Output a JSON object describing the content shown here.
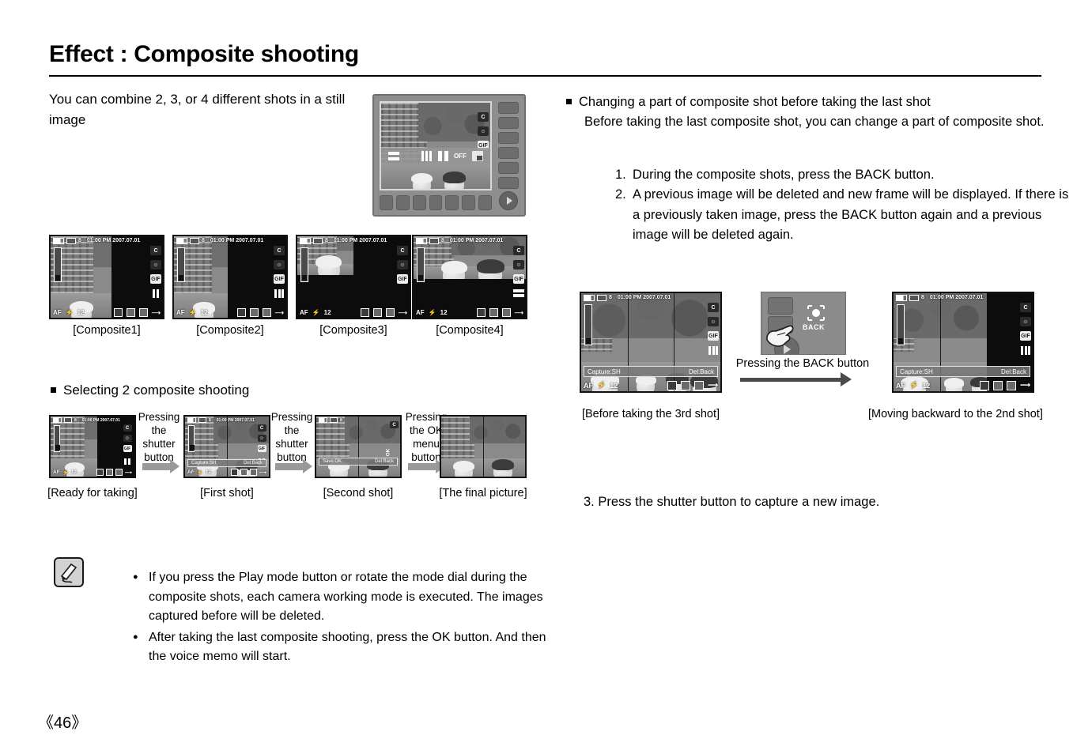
{
  "page": {
    "title": "Effect : Composite shooting",
    "number": "《46》"
  },
  "left": {
    "intro": "You can combine 2, 3, or 4 different shots in a still image",
    "composite_labels": [
      "[Composite1]",
      "[Composite2]",
      "[Composite3]",
      "[Composite4]"
    ],
    "section_heading": "Selecting 2 composite shooting",
    "sequence_labels": [
      "[Ready for taking]",
      "[First shot]",
      "[Second shot]",
      "[The final picture]"
    ],
    "sequence_actions": [
      "Pressing\nthe shutter\nbutton",
      "Pressing\nthe shutter\nbutton",
      "Pressing\nthe OK\nmenu button"
    ],
    "notes": [
      "If you press the Play mode button or rotate the mode dial during the composite shots, each camera working mode is executed. The images captured before will be deleted.",
      "After taking the last composite shooting, press the OK button. And then the voice memo will start."
    ],
    "note_icon": "pencil-note-icon"
  },
  "right": {
    "heading": "Changing a part of composite shot before taking the last shot",
    "subheading": "Before taking the last composite shot, you can change a part of composite shot.",
    "steps": [
      {
        "num": "1.",
        "text": "During the composite shots, press the BACK button."
      },
      {
        "num": "2.",
        "text": "A previous image will be deleted and new frame will be displayed. If there is a previously taken image, press the BACK button again and a previous image will be deleted again."
      }
    ],
    "step3": "3. Press the shutter button to capture a new image.",
    "figure_labels": {
      "left": "[Before taking the 3rd shot]",
      "right": "[Moving backward to the 2nd shot]",
      "middle": "Pressing the BACK button"
    },
    "back_button_word": "BACK"
  },
  "lcd": {
    "datetime": "01:00 PM 2007.07.01",
    "shots_remaining": "8",
    "af": "AF",
    "resolution": "12",
    "capture_hint": "Capture:SH",
    "delete_hint": "Del:Back",
    "save_hint": "Save:OK",
    "gif_label": "GIF",
    "menu_off": "OFF",
    "icons": {
      "mode": "composite-mode-icon",
      "face": "face-detection-icon",
      "gif": "gif-icon",
      "battery": "battery-icon",
      "card": "memory-card-icon",
      "flash": "flash-icon",
      "macro": "macro-icon",
      "metering": "metering-icon",
      "iso": "iso-icon"
    },
    "menu_items": [
      "composite-2-horizontal",
      "composite-4-grid",
      "composite-3-vertical",
      "composite-2-vertical",
      "OFF",
      "composite-select-icon"
    ]
  },
  "colors": {
    "page_bg": "#ffffff",
    "text": "#000000",
    "camera_body": "#8e8e8e",
    "lcd_border": "#111111",
    "arrow_gray": "#9a9a9a",
    "arrow_dark": "#4a4a4a"
  }
}
